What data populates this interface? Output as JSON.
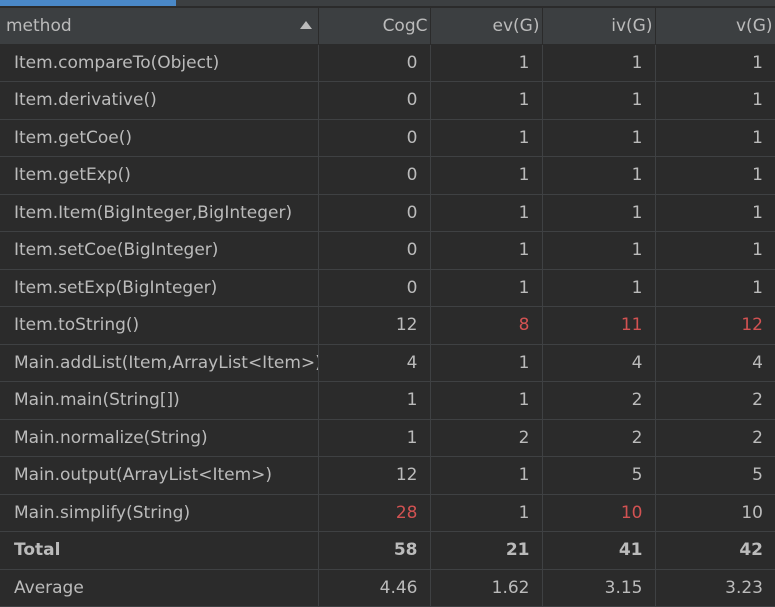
{
  "columns": [
    "method",
    "CogC",
    "ev(G)",
    "iv(G)",
    "v(G)"
  ],
  "colors": {
    "background": "#2b2b2b",
    "header_bg": "#3c3f41",
    "text": "#bbbbbb",
    "highlight": "#d25252",
    "accent": "#4a88c7"
  },
  "icons": {
    "sort": "sort-ascending-icon"
  },
  "rows": [
    {
      "method": "Item.compareTo(Object)",
      "cogc": "0",
      "ev": "1",
      "iv": "1",
      "v": "1"
    },
    {
      "method": "Item.derivative()",
      "cogc": "0",
      "ev": "1",
      "iv": "1",
      "v": "1"
    },
    {
      "method": "Item.getCoe()",
      "cogc": "0",
      "ev": "1",
      "iv": "1",
      "v": "1"
    },
    {
      "method": "Item.getExp()",
      "cogc": "0",
      "ev": "1",
      "iv": "1",
      "v": "1"
    },
    {
      "method": "Item.Item(BigInteger,BigInteger)",
      "cogc": "0",
      "ev": "1",
      "iv": "1",
      "v": "1"
    },
    {
      "method": "Item.setCoe(BigInteger)",
      "cogc": "0",
      "ev": "1",
      "iv": "1",
      "v": "1"
    },
    {
      "method": "Item.setExp(BigInteger)",
      "cogc": "0",
      "ev": "1",
      "iv": "1",
      "v": "1"
    },
    {
      "method": "Item.toString()",
      "cogc": "12",
      "ev": "8",
      "iv": "11",
      "v": "12"
    },
    {
      "method": "Main.addList(Item,ArrayList<Item>)",
      "cogc": "4",
      "ev": "1",
      "iv": "4",
      "v": "4"
    },
    {
      "method": "Main.main(String[])",
      "cogc": "1",
      "ev": "1",
      "iv": "2",
      "v": "2"
    },
    {
      "method": "Main.normalize(String)",
      "cogc": "1",
      "ev": "2",
      "iv": "2",
      "v": "2"
    },
    {
      "method": "Main.output(ArrayList<Item>)",
      "cogc": "12",
      "ev": "1",
      "iv": "5",
      "v": "5"
    },
    {
      "method": "Main.simplify(String)",
      "cogc": "28",
      "ev": "1",
      "iv": "10",
      "v": "10"
    }
  ],
  "total": {
    "label": "Total",
    "cogc": "58",
    "ev": "21",
    "iv": "41",
    "v": "42"
  },
  "average": {
    "label": "Average",
    "cogc": "4.46",
    "ev": "1.62",
    "iv": "3.15",
    "v": "3.23"
  }
}
